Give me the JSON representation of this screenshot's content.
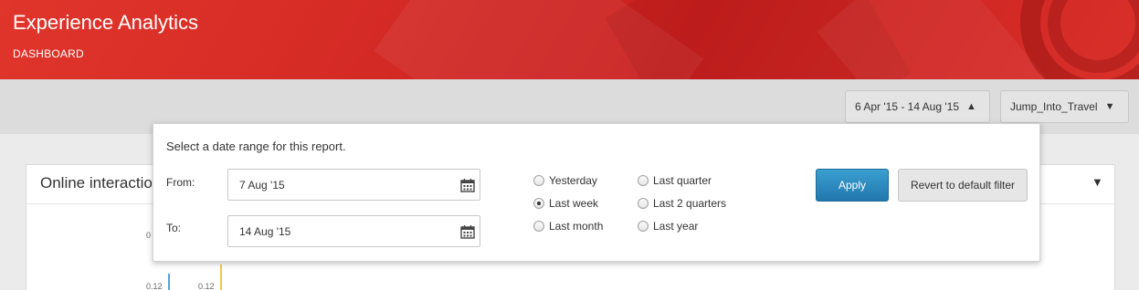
{
  "header": {
    "title": "Experience Analytics",
    "subtitle": "DASHBOARD"
  },
  "toolbar": {
    "date_range_label": "6 Apr '15 - 14 Aug '15",
    "date_range_icon": "caret-up-icon",
    "site_label": "Jump_Into_Travel",
    "site_icon": "caret-down-icon"
  },
  "panel": {
    "title": "Online interactio",
    "ticks": [
      "0",
      "0.12",
      "0.12"
    ]
  },
  "date_popup": {
    "title": "Select a date range for this report.",
    "from_label": "From:",
    "from_value": "7 Aug '15",
    "to_label": "To:",
    "to_value": "14 Aug '15",
    "presets": [
      {
        "label": "Yesterday",
        "checked": false
      },
      {
        "label": "Last week",
        "checked": true
      },
      {
        "label": "Last month",
        "checked": false
      },
      {
        "label": "Last quarter",
        "checked": false
      },
      {
        "label": "Last 2 quarters",
        "checked": false
      },
      {
        "label": "Last year",
        "checked": false
      }
    ],
    "apply_label": "Apply",
    "revert_label": "Revert to default filter"
  },
  "colors": {
    "brand_red": "#d42a25",
    "apply_blue": "#2a87bf",
    "axis_blue": "#4aa3df",
    "axis_yellow": "#f3c94a"
  }
}
